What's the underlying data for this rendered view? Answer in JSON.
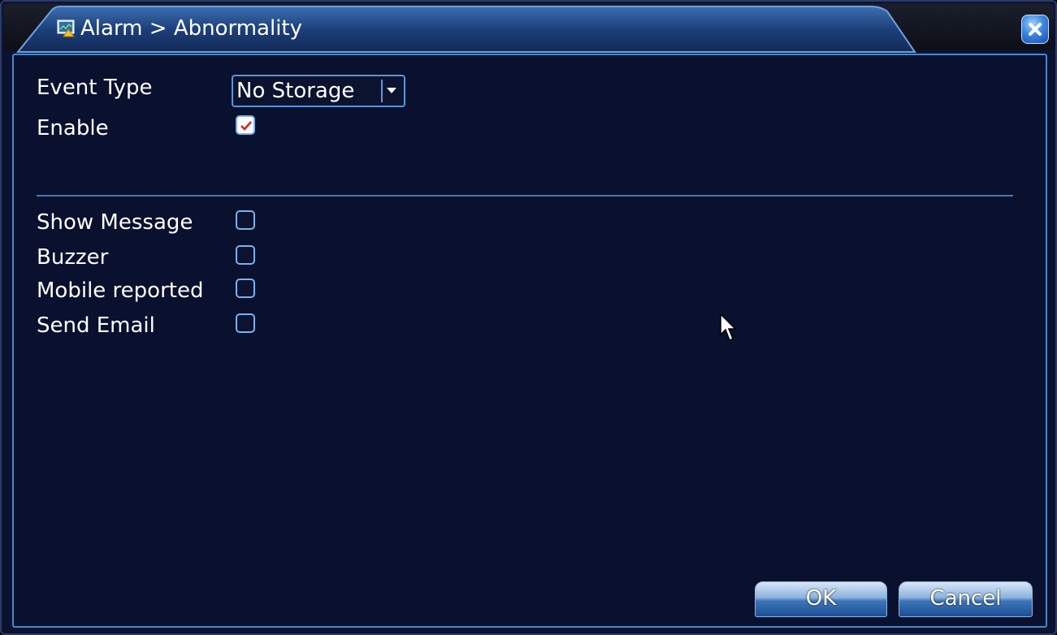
{
  "window": {
    "title": "Alarm > Abnormality",
    "title_icon": "monitor-icon",
    "close_icon": "close-icon"
  },
  "form": {
    "event_type_label": "Event Type",
    "event_type_value": "No Storage",
    "enable_label": "Enable",
    "enable_checked": true
  },
  "actions": [
    {
      "label": "Show Message",
      "checked": false
    },
    {
      "label": "Buzzer",
      "checked": false
    },
    {
      "label": "Mobile reported",
      "checked": false
    },
    {
      "label": "Send Email",
      "checked": false
    }
  ],
  "buttons": {
    "ok_label": "OK",
    "cancel_label": "Cancel"
  },
  "colors": {
    "background": "#0b1330",
    "border_accent": "#4c86c9",
    "check_mark": "#e02020"
  }
}
